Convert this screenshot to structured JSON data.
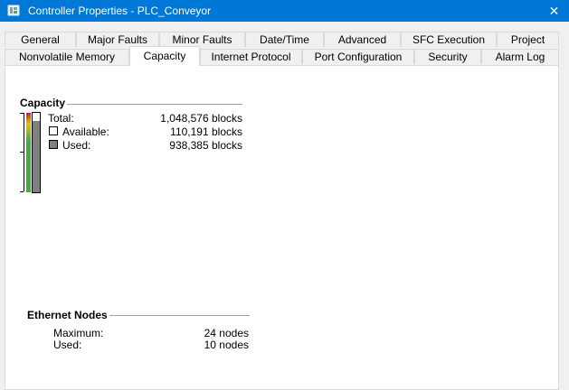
{
  "window": {
    "title": "Controller Properties - PLC_Conveyor",
    "close_glyph": "✕",
    "icon": "controller-icon"
  },
  "tabs_row1": [
    "General",
    "Major Faults",
    "Minor Faults",
    "Date/Time",
    "Advanced",
    "SFC Execution",
    "Project"
  ],
  "tabs_row2": [
    "Nonvolatile Memory",
    "Capacity",
    "Internet Protocol",
    "Port Configuration",
    "Security",
    "Alarm Log"
  ],
  "active_tab": "Capacity",
  "capacity": {
    "title": "Capacity",
    "total_label": "Total:",
    "total_value": "1,048,576 blocks",
    "available_label": "Available:",
    "available_value": "110,191 blocks",
    "used_label": "Used:",
    "used_value": "938,385 blocks",
    "used_fraction": 0.895,
    "colors": {
      "gauge_red": "#e81123",
      "gauge_yellow": "#f0c000",
      "gauge_green": "#3cb043",
      "used_fill": "#808080"
    }
  },
  "ethernet": {
    "title": "Ethernet Nodes",
    "maximum_label": "Maximum:",
    "maximum_value": "24 nodes",
    "used_label": "Used:",
    "used_value": "10 nodes"
  }
}
